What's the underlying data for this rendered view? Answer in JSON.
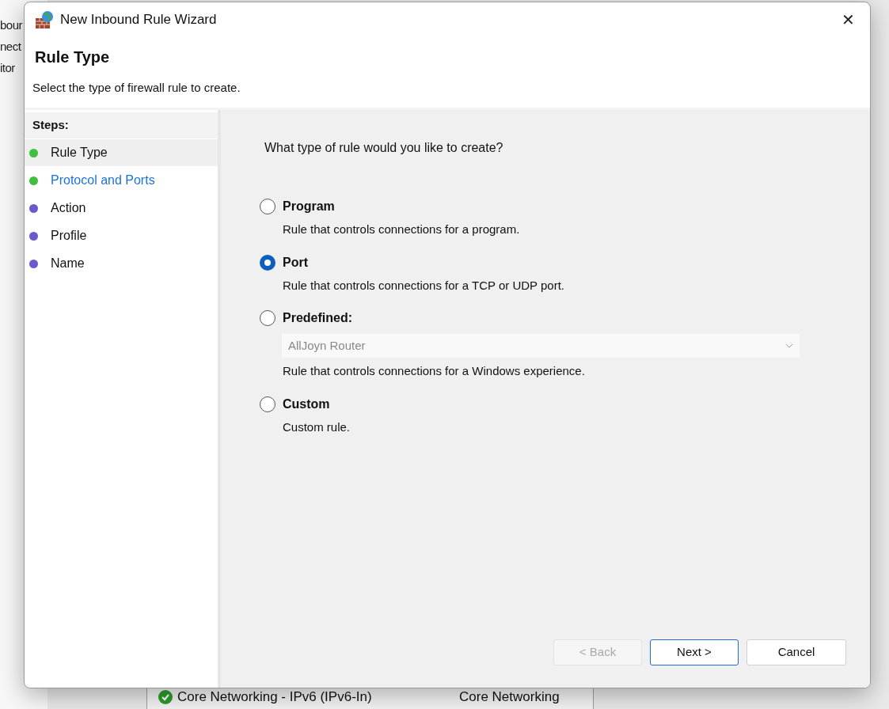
{
  "background_window": {
    "nav_items": [
      "bour",
      "nect",
      "itor"
    ],
    "rows": [
      {
        "name": "Core Networking - IPv6 (IPv6-In)",
        "group": "Core Networking",
        "enabled": true
      }
    ]
  },
  "dialog": {
    "title": "New Inbound Rule Wizard",
    "close": "✕",
    "header": {
      "title": "Rule Type",
      "subtitle": "Select the type of firewall rule to create."
    },
    "steps_heading": "Steps:",
    "steps": [
      {
        "label": "Rule Type",
        "selected": true,
        "link": false,
        "color": "#3fbf3f"
      },
      {
        "label": "Protocol and Ports",
        "selected": false,
        "link": true,
        "color": "#3fbf3f"
      },
      {
        "label": "Action",
        "selected": false,
        "link": false,
        "color": "#6a5acd"
      },
      {
        "label": "Profile",
        "selected": false,
        "link": false,
        "color": "#6a5acd"
      },
      {
        "label": "Name",
        "selected": false,
        "link": false,
        "color": "#6a5acd"
      }
    ],
    "question": "What type of rule would you like to create?",
    "options": [
      {
        "label": "Program",
        "description": "Rule that controls connections for a program.",
        "selected": false
      },
      {
        "label": "Port",
        "description": "Rule that controls connections for a TCP or UDP port.",
        "selected": true
      },
      {
        "label": "Predefined:",
        "description": "Rule that controls connections for a Windows experience.",
        "selected": false,
        "dropdown": {
          "value": "AllJoyn Router",
          "disabled": true
        }
      },
      {
        "label": "Custom",
        "description": "Custom rule.",
        "selected": false
      }
    ],
    "buttons": [
      {
        "label": "< Back",
        "disabled": true,
        "default": false
      },
      {
        "label": "Next >",
        "disabled": false,
        "default": true
      },
      {
        "label": "Cancel",
        "disabled": false,
        "default": false
      }
    ]
  }
}
